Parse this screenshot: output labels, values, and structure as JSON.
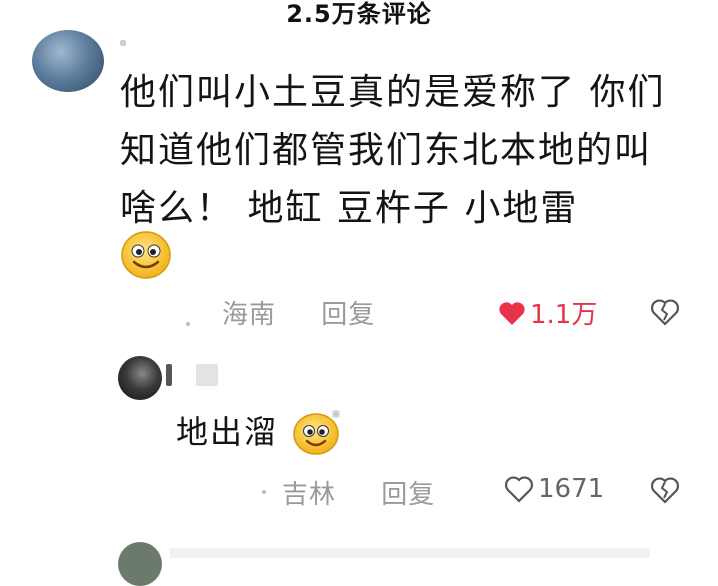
{
  "header": {
    "title": "2.5万条评论"
  },
  "comments": [
    {
      "text": "他们叫小土豆真的是爱称了  你们知道他们都管我们东北本地的叫啥么！ 地缸  豆杵子  小地雷",
      "location": "海南",
      "reply_label": "回复",
      "likes": "1.1万",
      "liked": true,
      "colors": {
        "like": "#e8334a"
      }
    },
    {
      "text": "地出溜",
      "location": "吉林",
      "reply_label": "回复",
      "likes": "1671",
      "liked": false
    }
  ]
}
